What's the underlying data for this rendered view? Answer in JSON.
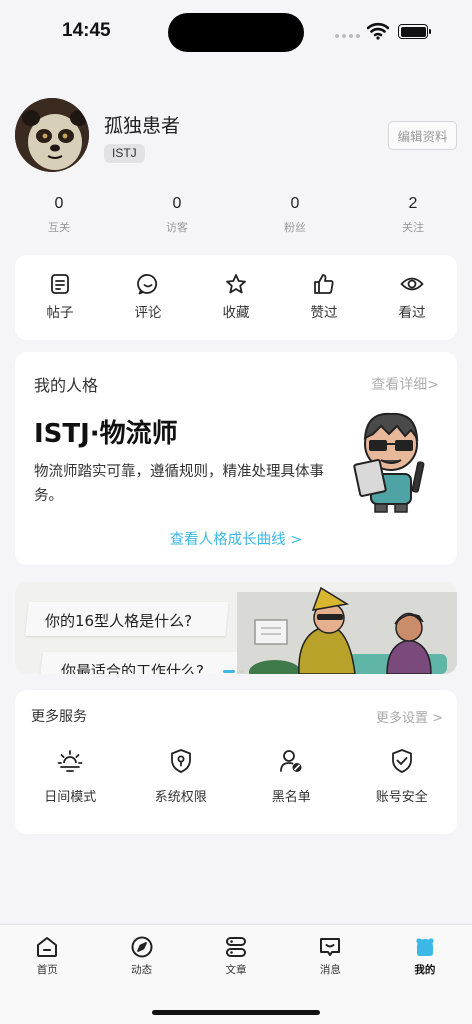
{
  "status_bar": {
    "time": "14:45"
  },
  "profile": {
    "username": "孤独患者",
    "mbti": "ISTJ",
    "edit_label": "编辑资料"
  },
  "stats": [
    {
      "value": "0",
      "label": "互关"
    },
    {
      "value": "0",
      "label": "访客"
    },
    {
      "value": "0",
      "label": "粉丝"
    },
    {
      "value": "2",
      "label": "关注"
    }
  ],
  "shortcuts": [
    {
      "label": "帖子",
      "icon": "post-icon"
    },
    {
      "label": "评论",
      "icon": "comment-icon"
    },
    {
      "label": "收藏",
      "icon": "star-icon"
    },
    {
      "label": "赞过",
      "icon": "thumbs-up-icon"
    },
    {
      "label": "看过",
      "icon": "eye-icon"
    }
  ],
  "personality": {
    "title": "我的人格",
    "detail_link": "查看详细>",
    "type": "ISTJ·物流师",
    "description": "物流师踏实可靠，遵循规则，精准处理具体事务。",
    "growth_link": "查看人格成长曲线 >"
  },
  "banner": {
    "line1": "你的16型人格是什么?",
    "line2": "你最适合的工作什么?"
  },
  "services": {
    "title": "更多服务",
    "settings_link": "更多设置 >",
    "items": [
      {
        "label": "日间模式",
        "icon": "sun-icon"
      },
      {
        "label": "系统权限",
        "icon": "shield-lock-icon"
      },
      {
        "label": "黑名单",
        "icon": "user-block-icon"
      },
      {
        "label": "账号安全",
        "icon": "shield-check-icon"
      }
    ]
  },
  "tabbar": [
    {
      "label": "首页",
      "icon": "home-icon"
    },
    {
      "label": "动态",
      "icon": "compass-icon"
    },
    {
      "label": "文章",
      "icon": "article-icon"
    },
    {
      "label": "消息",
      "icon": "message-icon"
    },
    {
      "label": "我的",
      "icon": "profile-icon",
      "active": true
    }
  ],
  "colors": {
    "accent": "#3cb8e6",
    "background": "#f5f5f7"
  }
}
